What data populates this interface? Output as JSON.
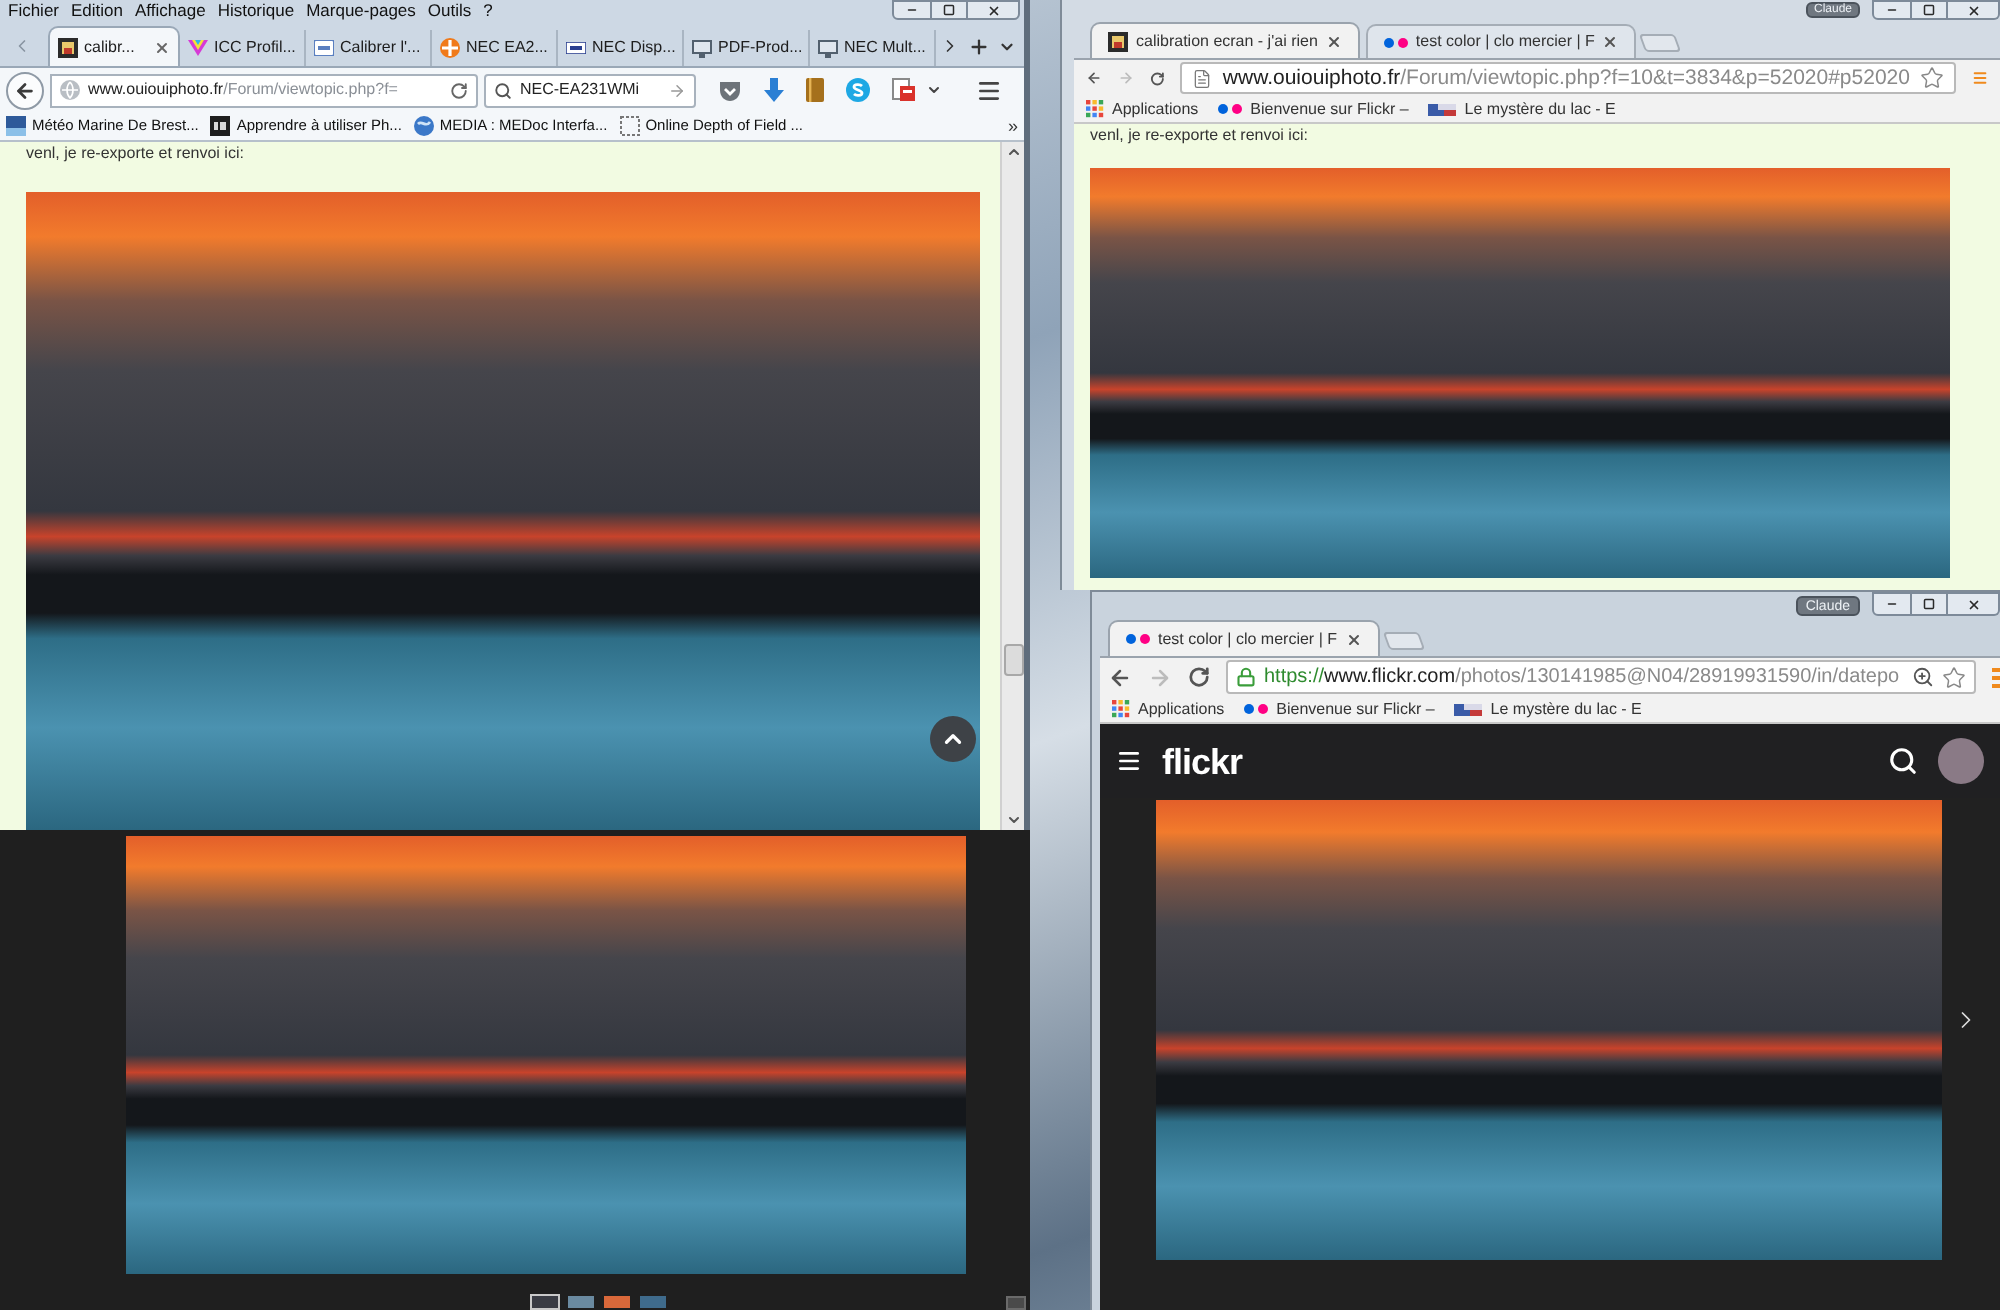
{
  "firefox": {
    "menu": [
      "Fichier",
      "Edition",
      "Affichage",
      "Historique",
      "Marque-pages",
      "Outils",
      "?"
    ],
    "tabs": [
      {
        "label": "calibr...",
        "selected": true
      },
      {
        "label": "ICC Profil...",
        "selected": false
      },
      {
        "label": "Calibrer l'...",
        "selected": false
      },
      {
        "label": "NEC EA2...",
        "selected": false
      },
      {
        "label": "NEC Disp...",
        "selected": false
      },
      {
        "label": "PDF-Prod...",
        "selected": false
      },
      {
        "label": "NEC Mult...",
        "selected": false
      }
    ],
    "url": {
      "host": "www.ouiouiphoto.fr",
      "path": "/Forum/viewtopic.php?f="
    },
    "search": {
      "value": "NEC-EA231WMi"
    },
    "bookmarks": [
      "Météo Marine De Brest...",
      "Apprendre à utiliser Ph...",
      "MEDIA : MEDoc Interfa...",
      "Online Depth of Field ..."
    ],
    "bookmarks_overflow": "»",
    "content_text": "venl, je re-exporte et renvoi ici:"
  },
  "viewer": {
    "thumbnails": [
      {
        "selected": true
      },
      {
        "selected": false
      },
      {
        "selected": false
      },
      {
        "selected": false
      }
    ]
  },
  "chrome": {
    "profile": "Claude",
    "tabs": [
      {
        "label": "calibration ecran - j'ai rien",
        "selected": true
      },
      {
        "label": "test color | clo mercier | F",
        "selected": false
      }
    ],
    "url": {
      "host": "www.ouiouiphoto.fr",
      "path": "/Forum/viewtopic.php?f=10&t=3834&p=52020#p52020"
    },
    "bookmarks": [
      "Applications",
      "Bienvenue sur Flickr –",
      "Le mystère du lac - E"
    ],
    "content_text": "venl, je re-exporte et renvoi ici:"
  },
  "flickr_window": {
    "profile": "Claude",
    "tabs": [
      {
        "label": "test color | clo mercier | F",
        "selected": true
      }
    ],
    "url": {
      "scheme": "https://",
      "host": "www.flickr.com",
      "path": "/photos/130141985@N04/28919931590/in/datepo"
    },
    "bookmarks": [
      "Applications",
      "Bienvenue sur Flickr –",
      "Le mystère du lac - E"
    ],
    "logo": "flickr"
  }
}
